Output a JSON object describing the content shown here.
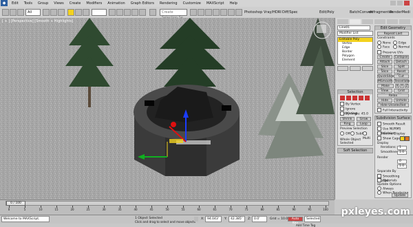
{
  "menubar": {
    "items": [
      "Edit",
      "Tools",
      "Group",
      "Views",
      "Create",
      "Modifiers",
      "Animation",
      "Graph Editors",
      "Rendering",
      "Customize",
      "MAXScript",
      "Help"
    ]
  },
  "toolbar": {
    "filter_value": "All",
    "selection_set_placeholder": "Create Selection Se",
    "right_tabs": [
      "Photoshop",
      "Vray/HDRI",
      "Diff/Spec",
      "Edit/Poly",
      "BatchConvert",
      "defragmenter",
      "RenderMedi"
    ]
  },
  "viewport": {
    "label": "[ + ] [Perspective] [Smooth + Highlights]"
  },
  "command_panel": {
    "object_name": "Line01",
    "modifier_list": "Modifier List",
    "stack": [
      "Editable Poly",
      "Vertex",
      "Edge",
      "Border",
      "Polygon",
      "Element"
    ],
    "stack_buttons": [
      "Unhide All",
      "Hide Selected",
      "Hide Unselected"
    ],
    "selection_title": "Selection",
    "selection_checks": [
      "By Vertex",
      "Ignore Backfacing",
      "By Angle: 45.0"
    ],
    "selection_buttons": [
      "Shrink",
      "Grow",
      "Ring",
      "Loop"
    ],
    "preview_title": "Preview Selection",
    "preview_opts": [
      "Off",
      "SubObj",
      "Multi"
    ],
    "whole_object": "Whole Object Selected",
    "soft_selection": "Soft Selection",
    "edit_geometry_title": "Edit Geometry",
    "repeat_last": "Repeat Last",
    "constraints_label": "Constraints",
    "constraints": [
      "None",
      "Edge",
      "Face",
      "Normal"
    ],
    "preserve_uvs": "Preserve UVs",
    "edit_buttons": [
      "Create",
      "Collapse",
      "Attach",
      "Detach",
      "Slice Plane",
      "Split",
      "Slice",
      "Reset Plane",
      "QuickSlice",
      "Cut",
      "MSmooth",
      "Tessellate",
      "Make Planar",
      "X",
      "Y",
      "Z",
      "View Align",
      "Grid Align",
      "Relax",
      "Hide Selected",
      "Unhide All",
      "Hide Unselected",
      "Named Selections:",
      "Copy",
      "Paste",
      "Delete Isolated Vertices",
      "Full Interactivity"
    ],
    "subdivision_title": "Subdivision Surface",
    "subdivision_checks": [
      "Smooth Result",
      "Use NURMS Subdivision",
      "Isoline Display",
      "Show Cage"
    ],
    "display_label": "Display",
    "iterations_label": "Iterations:",
    "iterations_value": "1",
    "smoothness_label": "Smoothness:",
    "smoothness_value": "1.0",
    "render_label": "Render",
    "render_iterations": "0",
    "render_smoothness": "1.0",
    "separate_by": "Separate By",
    "separate_opts": [
      "Smoothing Groups",
      "Materials"
    ],
    "update_options": "Update Options",
    "update_opts": [
      "Always",
      "When Rendering",
      "Manually"
    ],
    "update_button": "Update"
  },
  "timeline": {
    "thumb": "0 / 100",
    "ticks": [
      "0",
      "5",
      "10",
      "15",
      "20",
      "25",
      "30",
      "35",
      "40",
      "45",
      "50",
      "55",
      "60",
      "65",
      "70",
      "75",
      "80",
      "85",
      "90",
      "95",
      "100"
    ]
  },
  "status": {
    "script_line": "Welcome to MAXScript.",
    "objects_selected": "1 Object Selected",
    "prompt": "Click and drag to select and move objects",
    "x_label": "X:",
    "x_value": "94.043'",
    "y_label": "Y:",
    "y_value": "42.385'",
    "z_label": "Z:",
    "z_value": "0.0'",
    "grid": "Grid = 10.0'",
    "auto_key": "Auto Key",
    "selected": "Selected",
    "set_key": "Set Key",
    "key_filters": "Key Filters...",
    "add_time_tag": "Add Time Tag"
  },
  "watermark": "pxleyes.com",
  "colors": {
    "viewport_bg": "#a3a3a3",
    "object": "#3a3a3a",
    "gizmo_blue": "#1a3cff",
    "gizmo_red": "#e01010",
    "gizmo_green": "#10b020",
    "selected_yellow": "#f3d21f"
  }
}
